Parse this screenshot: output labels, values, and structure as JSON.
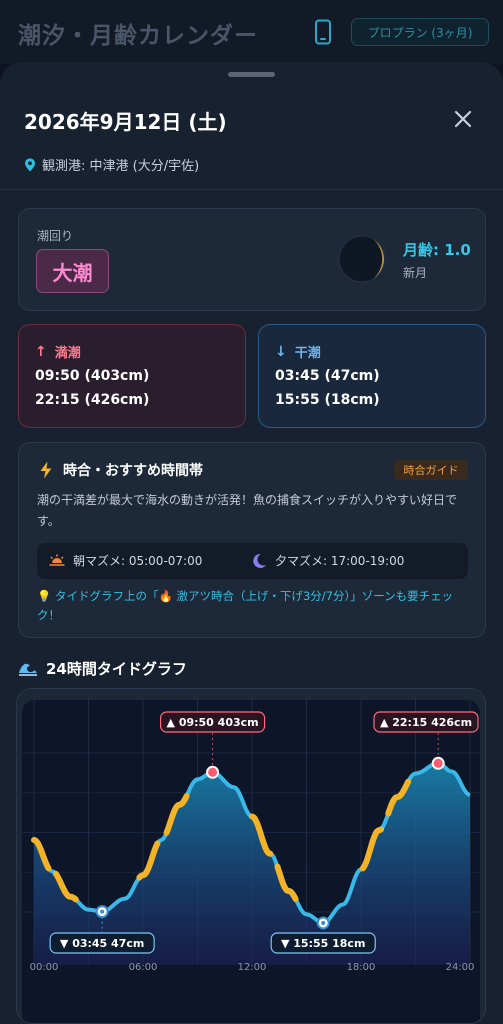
{
  "header": {
    "app_title": "潮汐・月齢カレンダー",
    "plan_button": "プロプラン (3ヶ月)"
  },
  "sheet": {
    "date_title": "2026年9月12日 (土)",
    "port": "観測港: 中津港 (大分/宇佐)"
  },
  "tide": {
    "label": "潮回り",
    "name": "大潮",
    "moon_age": "月齢: 1.0",
    "moon_name": "新月"
  },
  "high_tide": {
    "arrow": "↑",
    "title": "満潮",
    "times": [
      "09:50 (403cm)",
      "22:15 (426cm)"
    ]
  },
  "low_tide": {
    "arrow": "↓",
    "title": "干潮",
    "times": [
      "03:45 (47cm)",
      "15:55 (18cm)"
    ]
  },
  "guide": {
    "title": "時合・おすすめ時間帯",
    "badge": "時合ガイド",
    "description": "潮の干満差が最大で海水の動きが活発！魚の捕食スイッチが入りやすい好日です。",
    "morning": "朝マズメ: 05:00-07:00",
    "evening": "夕マズメ: 17:00-19:00",
    "tip": "💡 タイドグラフ上の「🔥 激アツ時合（上げ・下げ3分/7分）」ゾーンも要チェック！"
  },
  "graph": {
    "title": "24時間タイドグラフ",
    "icon": "wave-icon"
  },
  "chart_data": {
    "type": "line",
    "title": "24時間タイドグラフ",
    "x_unit": "hour",
    "xlim": [
      0,
      24
    ],
    "ylim": [
      0,
      460
    ],
    "x_ticks": [
      "00:00",
      "06:00",
      "12:00",
      "18:00",
      "24:00"
    ],
    "series": [
      {
        "x": [
          0,
          1,
          2,
          3,
          3.75,
          5,
          6,
          7,
          8,
          9,
          9.83,
          11,
          12,
          13,
          14,
          15,
          15.92,
          17,
          18,
          19,
          20,
          21,
          22.25,
          23,
          24
        ],
        "values": [
          230,
          150,
          85,
          52,
          47,
          80,
          140,
          230,
          320,
          385,
          403,
          365,
          290,
          195,
          100,
          40,
          18,
          65,
          155,
          255,
          340,
          400,
          426,
          405,
          345
        ]
      }
    ],
    "extremes": [
      {
        "kind": "high",
        "x": 9.83,
        "value": 403,
        "label": "▲ 09:50 403cm"
      },
      {
        "kind": "low",
        "x": 3.75,
        "value": 47,
        "label": "▼ 03:45 47cm"
      },
      {
        "kind": "high",
        "x": 22.25,
        "value": 426,
        "label": "▲ 22:15 426cm"
      },
      {
        "kind": "low",
        "x": 15.92,
        "value": 18,
        "label": "▼ 15:55 18cm"
      }
    ],
    "hot_zones": [
      [
        0,
        0.8
      ],
      [
        1.2,
        2.3
      ],
      [
        5.8,
        6.8
      ],
      [
        7.3,
        8.4
      ],
      [
        12.0,
        13.0
      ],
      [
        13.4,
        14.4
      ],
      [
        18.1,
        19.1
      ],
      [
        19.5,
        20.6
      ]
    ],
    "colors": {
      "line": "#3ab8ea",
      "hot": "#f3b329",
      "high": "#ff6b7e",
      "low": "#7fc4f5"
    }
  }
}
